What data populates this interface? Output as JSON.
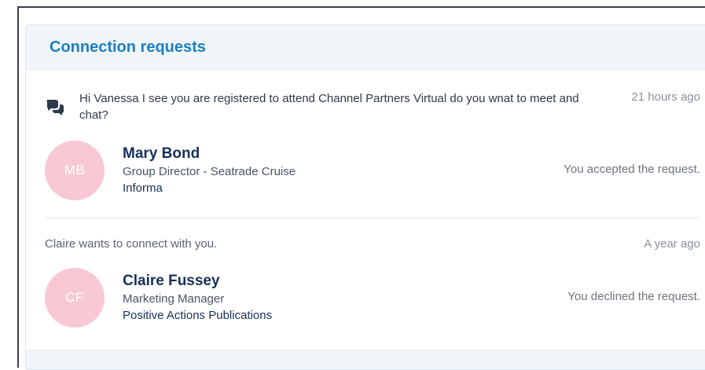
{
  "panel": {
    "title": "Connection requests"
  },
  "requests": [
    {
      "message": "Hi Vanessa I see you are registered to attend Channel Partners Virtual do you wnat to meet and chat?",
      "time": "21 hours ago",
      "has_chat_icon": true,
      "icon": "chat-bubbles-icon",
      "person": {
        "initials": "MB",
        "name": "Mary Bond",
        "role": "Group Director - Seatrade Cruise",
        "company": "Informa"
      },
      "status": "You accepted the request."
    },
    {
      "message": "Claire wants to connect with you.",
      "time": "A year ago",
      "has_chat_icon": false,
      "person": {
        "initials": "CF",
        "name": "Claire Fussey",
        "role": "Marketing Manager",
        "company": "Positive Actions Publications"
      },
      "status": "You declined the request."
    }
  ],
  "colors": {
    "title": "#1b7fc2",
    "name": "#16305a",
    "avatar_bg": "#f8c9d4",
    "header_bg": "#f1f6fa"
  }
}
